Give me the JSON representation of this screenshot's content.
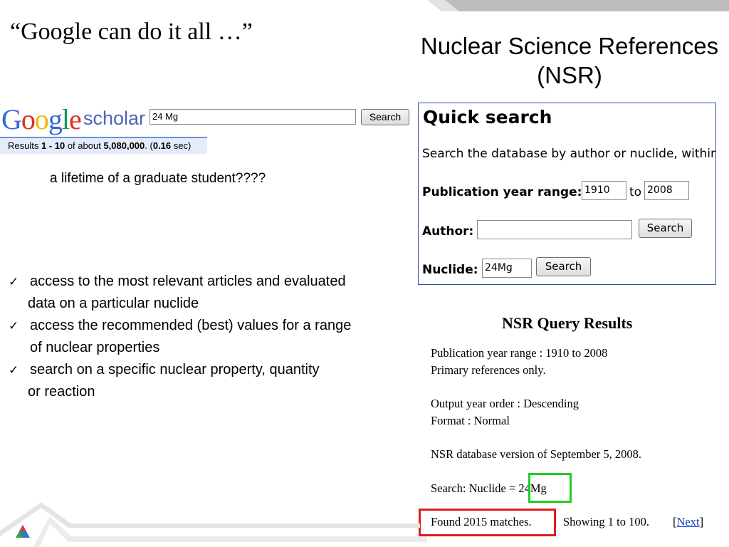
{
  "slide": {
    "title_left": "“Google can do it all …”",
    "title_right_line1": "Nuclear Science References",
    "title_right_line2": "(NSR)",
    "subtitle": "a lifetime of a graduate student????"
  },
  "google_scholar": {
    "logo_text": "Google",
    "scholar_text": "scholar",
    "search_value": "24 Mg",
    "search_button": "Search",
    "results_prefix": "Results ",
    "results_range": "1 - 10",
    "results_mid": " of about ",
    "results_count": "5,080,000",
    "results_time_prefix": ". (",
    "results_time": "0.16",
    "results_time_suffix": " sec)"
  },
  "bullets": [
    {
      "line1": "access to the most relevant articles and evaluated",
      "line2": "data on a particular nuclide"
    },
    {
      "line1": "access the recommended (best) values for a range",
      "line2": "of nuclear properties"
    },
    {
      "line1": "search on a specific nuclear property, quantity",
      "line2": "or reaction"
    }
  ],
  "quick_search": {
    "title": "Quick search",
    "description": "Search the database by author or nuclide, within",
    "pub_year_label": "Publication year range:",
    "year_from": "1910",
    "to_label": "to",
    "year_to": "2008",
    "author_label": "Author:",
    "author_value": "",
    "author_button": "Search",
    "nuclide_label": "Nuclide:",
    "nuclide_value": "24Mg",
    "nuclide_button": "Search"
  },
  "query_results": {
    "title": "NSR Query Results",
    "pub_range": "Publication year range : 1910 to 2008",
    "primary_refs": "Primary references only.",
    "output_order": "Output year order : Descending",
    "format": "Format : Normal",
    "db_version": "NSR database version of September 5, 2008.",
    "search_prefix": "Search: Nuclide = ",
    "search_value": "24Mg",
    "found": "Found 2015 matches.",
    "showing": "Showing 1 to 100.",
    "next_open": "[",
    "next_label": "Next",
    "next_close": "]"
  },
  "colors": {
    "green_highlight": "#1fce1f",
    "red_highlight": "#e31b1b",
    "link": "#1a3cc8",
    "quick_search_border": "#2e4f9e"
  }
}
